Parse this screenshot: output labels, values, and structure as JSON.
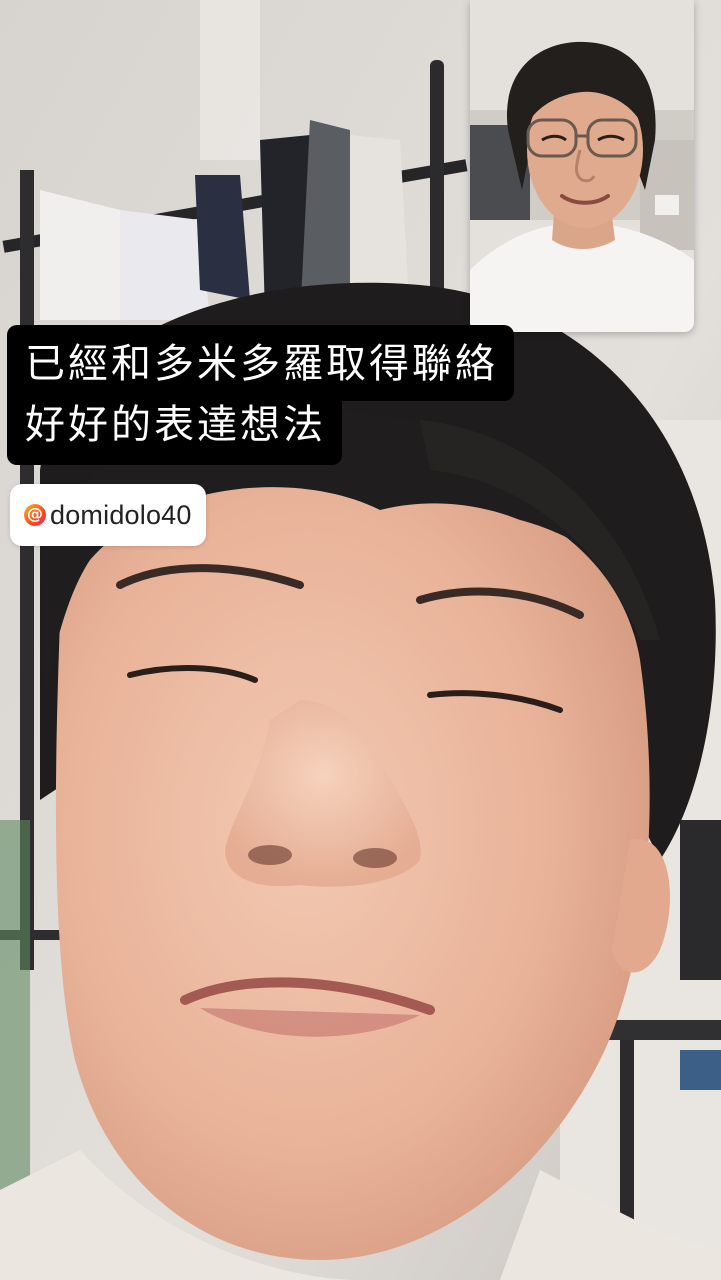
{
  "caption": {
    "line1": "已經和多米多羅取得聯絡",
    "line2": "好好的表達想法"
  },
  "handle": {
    "icon": "threads-icon",
    "text": "domidolo40"
  },
  "colors": {
    "caption_bg": "#000000",
    "caption_text": "#ffffff",
    "tag_bg": "#ffffff",
    "wall": "#dcd8d4",
    "skin": "#e9b9a0",
    "hair": "#1c1a1a"
  }
}
